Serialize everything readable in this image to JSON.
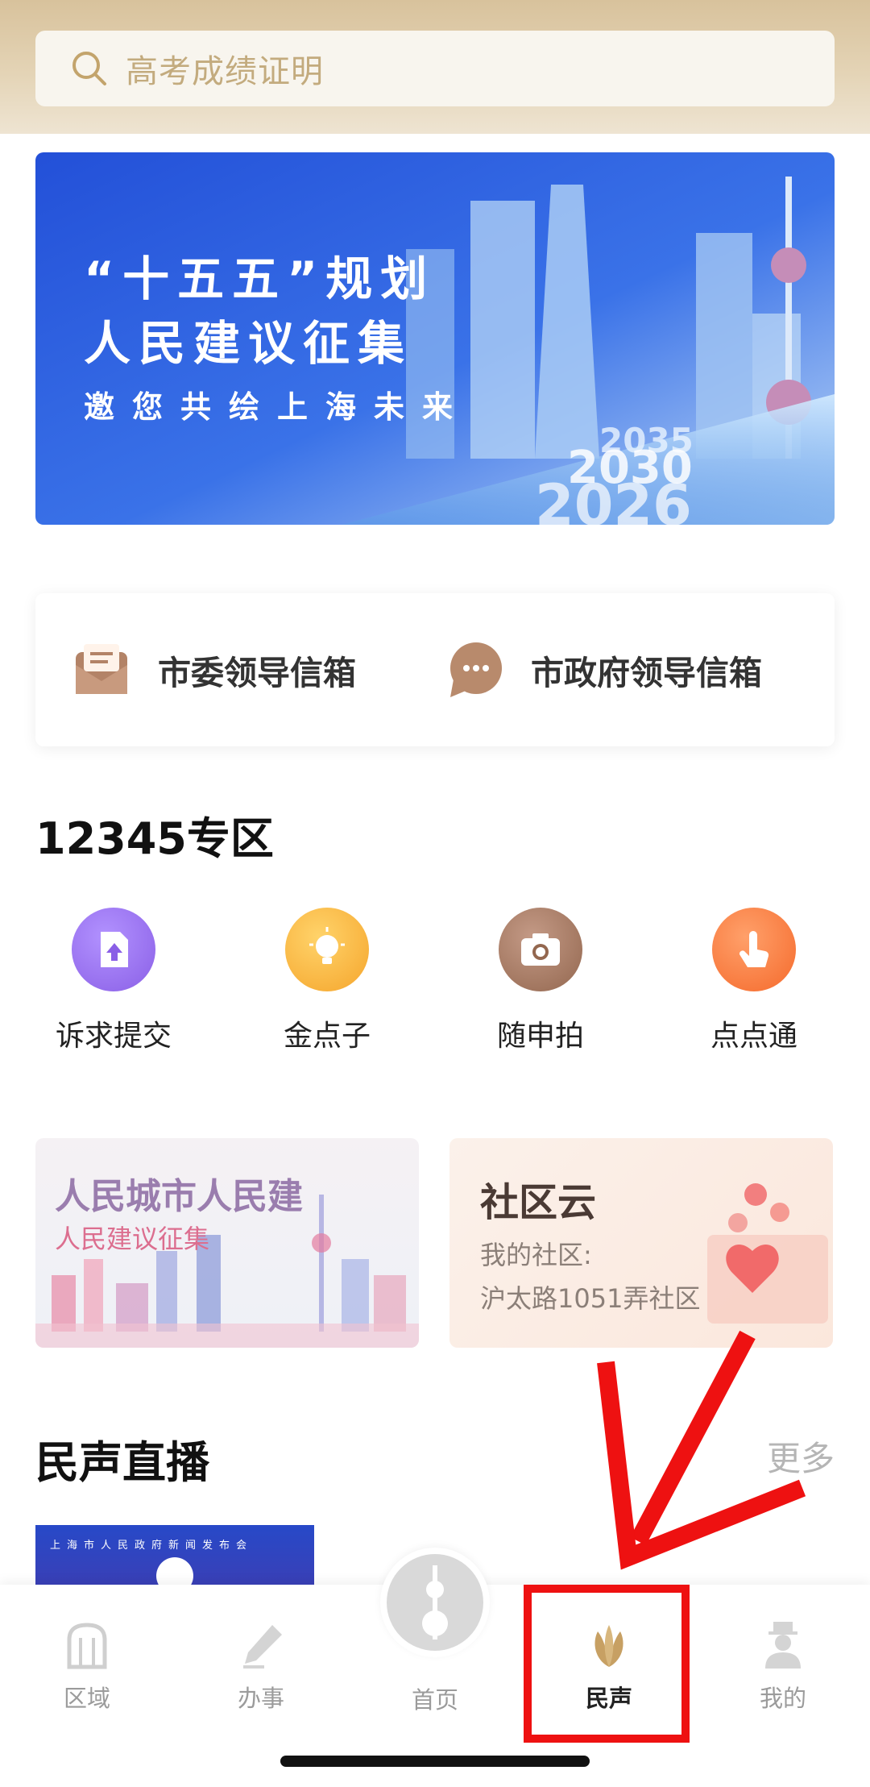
{
  "search": {
    "placeholder": "高考成绩证明"
  },
  "banner": {
    "line1": "“十五五”规划",
    "line2": "人民建议征集",
    "line3": "邀您共绘上海未来",
    "years": [
      "2035",
      "2030",
      "2026"
    ]
  },
  "mailbox": {
    "left_label": "市委领导信箱",
    "right_label": "市政府领导信箱"
  },
  "section_12345": {
    "title": "12345专区",
    "items": [
      {
        "label": "诉求提交",
        "icon": "upload-file-icon",
        "color": "#9b73f2"
      },
      {
        "label": "金点子",
        "icon": "lightbulb-icon",
        "color": "#f7b53c"
      },
      {
        "label": "随申拍",
        "icon": "camera-icon",
        "color": "#a57863"
      },
      {
        "label": "点点通",
        "icon": "finger-tap-icon",
        "color": "#f77a3a"
      }
    ]
  },
  "cards": {
    "left": {
      "title": "人民城市人民建",
      "subtitle": "人民建议征集"
    },
    "right": {
      "title": "社区云",
      "line1": "我的社区:",
      "line2": "沪太路1051弄社区"
    }
  },
  "live": {
    "title": "民声直播",
    "more": "更多",
    "thumb_text": "上海市人民政府新闻发布会"
  },
  "tabbar": {
    "tabs": [
      {
        "label": "区域",
        "icon": "district-icon"
      },
      {
        "label": "办事",
        "icon": "pen-icon"
      },
      {
        "label": "首页",
        "icon": "oriental-pearl-tower-icon"
      },
      {
        "label": "民声",
        "icon": "magnolia-icon",
        "active": true
      },
      {
        "label": "我的",
        "icon": "user-icon"
      }
    ]
  },
  "colors": {
    "accent_gold": "#c3a46c",
    "annotation_red": "#ee1111"
  }
}
